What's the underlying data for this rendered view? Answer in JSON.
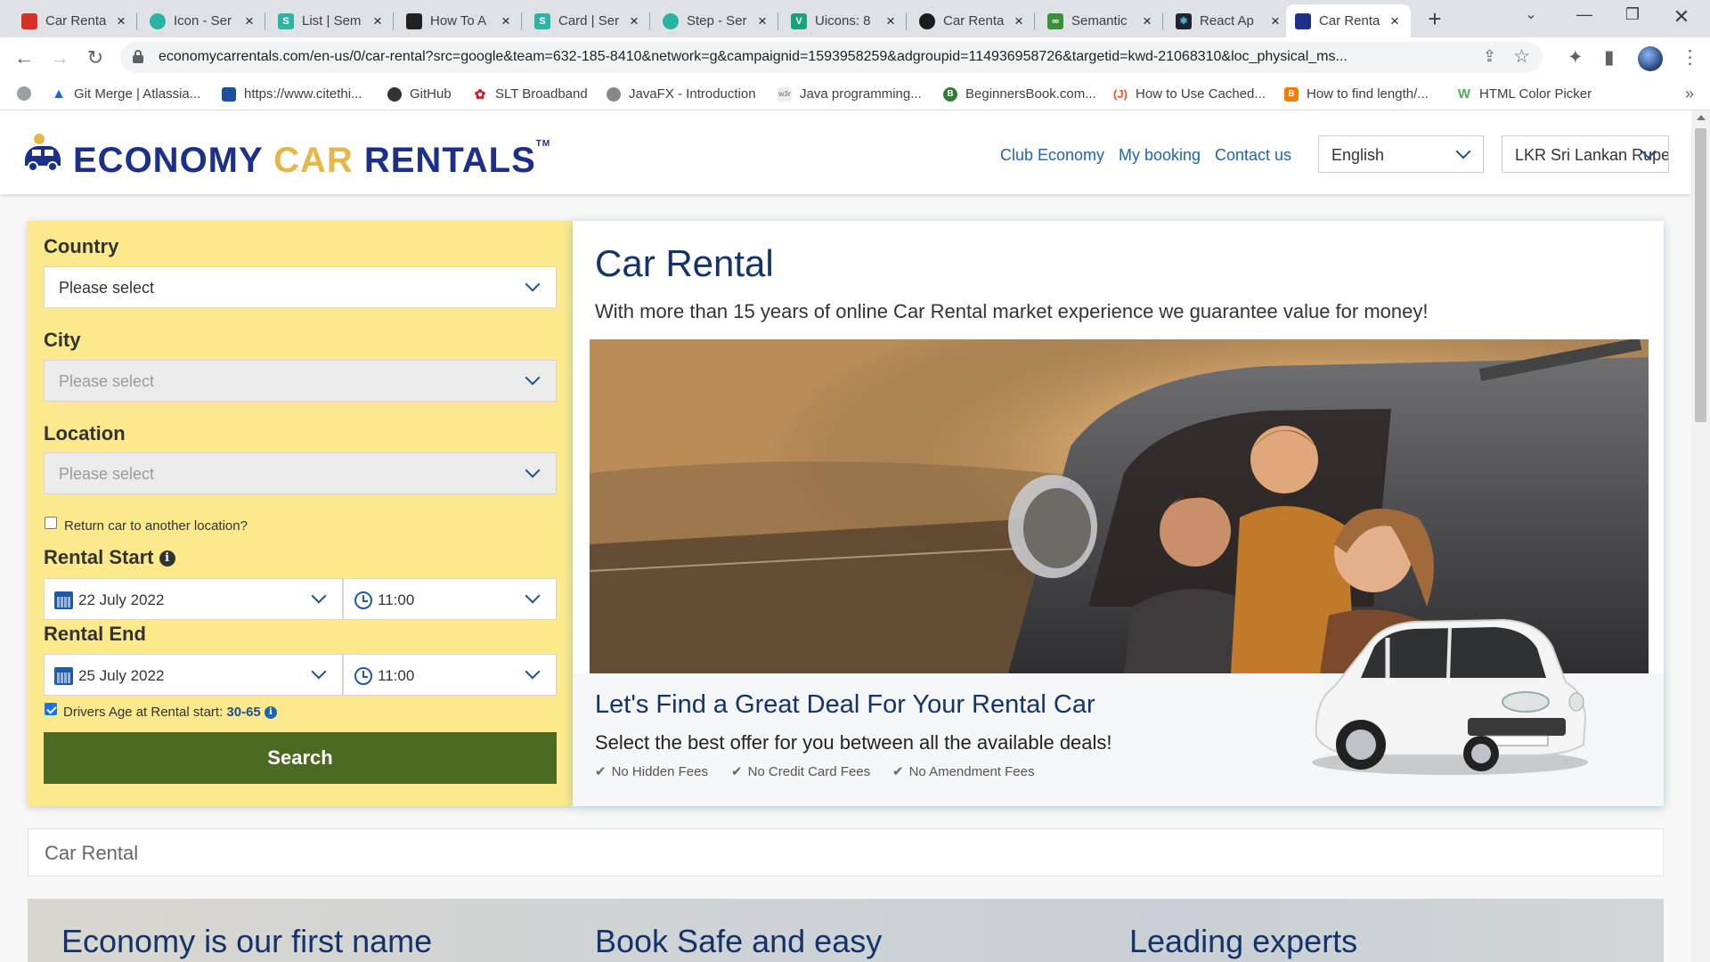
{
  "browser": {
    "tabs": [
      {
        "label": "Car Renta",
        "fav": "#d93025"
      },
      {
        "label": "Icon - Ser",
        "fav": "#2bb3a3"
      },
      {
        "label": "List | Sem",
        "fav": "#2bb3a3"
      },
      {
        "label": "How To A",
        "fav": "#222222"
      },
      {
        "label": "Card | Ser",
        "fav": "#2bb3a3"
      },
      {
        "label": "Step - Ser",
        "fav": "#2bb3a3"
      },
      {
        "label": "Uicons: 8",
        "fav": "#1aa37a"
      },
      {
        "label": "Car Renta",
        "fav": "#1c1c1c"
      },
      {
        "label": "Semantic",
        "fav": "#3a8f3a"
      },
      {
        "label": "React Ap",
        "fav": "#1c2433"
      },
      {
        "label": "Car Renta",
        "fav": "#1b2f8b"
      }
    ],
    "active_tab_index": 10,
    "url": "economycarrentals.com/en-us/0/car-rental?src=google&team=632-185-8410&network=g&campaignid=1593958259&adgroupid=114936958726&targetid=kwd-21068310&loc_physical_ms...",
    "bookmarks": [
      {
        "label": "",
        "fav": "#9aa0a6"
      },
      {
        "label": "Git Merge | Atlassia...",
        "fav": "#1868db"
      },
      {
        "label": "https://www.citethi...",
        "fav": "#1d4fa0"
      },
      {
        "label": "GitHub",
        "fav": "#333333"
      },
      {
        "label": "SLT Broadband",
        "fav": "#cf1c24"
      },
      {
        "label": "JavaFX - Introduction",
        "fav": "#888888"
      },
      {
        "label": "Java programming...",
        "fav": "#bbbbbb"
      },
      {
        "label": "BeginnersBook.com...",
        "fav": "#2e7d32"
      },
      {
        "label": "How to Use Cached...",
        "fav": "#e8552a"
      },
      {
        "label": "How to find length/...",
        "fav": "#f57c00"
      },
      {
        "label": "HTML Color Picker",
        "fav": "#4caf50"
      }
    ]
  },
  "header": {
    "logo_economy": "ECONOMY ",
    "logo_car": "CAR",
    "logo_rentals": " RENTALS",
    "logo_tm": "TM",
    "links": {
      "club": "Club Economy",
      "booking": "My booking",
      "contact": "Contact us"
    },
    "language": "English",
    "currency": "LKR Sri Lankan Rupee"
  },
  "form": {
    "country_label": "Country",
    "country_value": "Please select",
    "city_label": "City",
    "city_value": "Please select",
    "location_label": "Location",
    "location_value": "Please select",
    "return_label": "Return car to another location?",
    "return_checked": false,
    "start_label": "Rental Start",
    "start_date": "22 July 2022",
    "start_time": "11:00",
    "end_label": "Rental End",
    "end_date": "25 July 2022",
    "end_time": "11:00",
    "age_label": "Drivers Age at Rental start: ",
    "age_value": "30-65",
    "age_checked": true,
    "search_label": "Search"
  },
  "hero": {
    "title": "Car Rental",
    "subtitle": "With more than 15 years of online Car Rental market experience we guarantee value for money!",
    "deal_title": "Let's Find a Great Deal For Your Rental Car",
    "deal_sub": "Select the best offer for you between all the available deals!",
    "features": [
      "No Hidden Fees",
      "No Credit Card Fees",
      "No Amendment Fees"
    ]
  },
  "breadcrumb": "Car Rental",
  "info": {
    "col1": "Economy is our first name",
    "col2": "Book Safe and easy",
    "col3": "Leading experts"
  },
  "colors": {
    "brand_blue": "#1b2f8b",
    "brand_gold": "#e5b64a",
    "form_yellow": "#fbe98b",
    "search_green": "#4c6b22",
    "link_blue": "#1f64b0"
  }
}
